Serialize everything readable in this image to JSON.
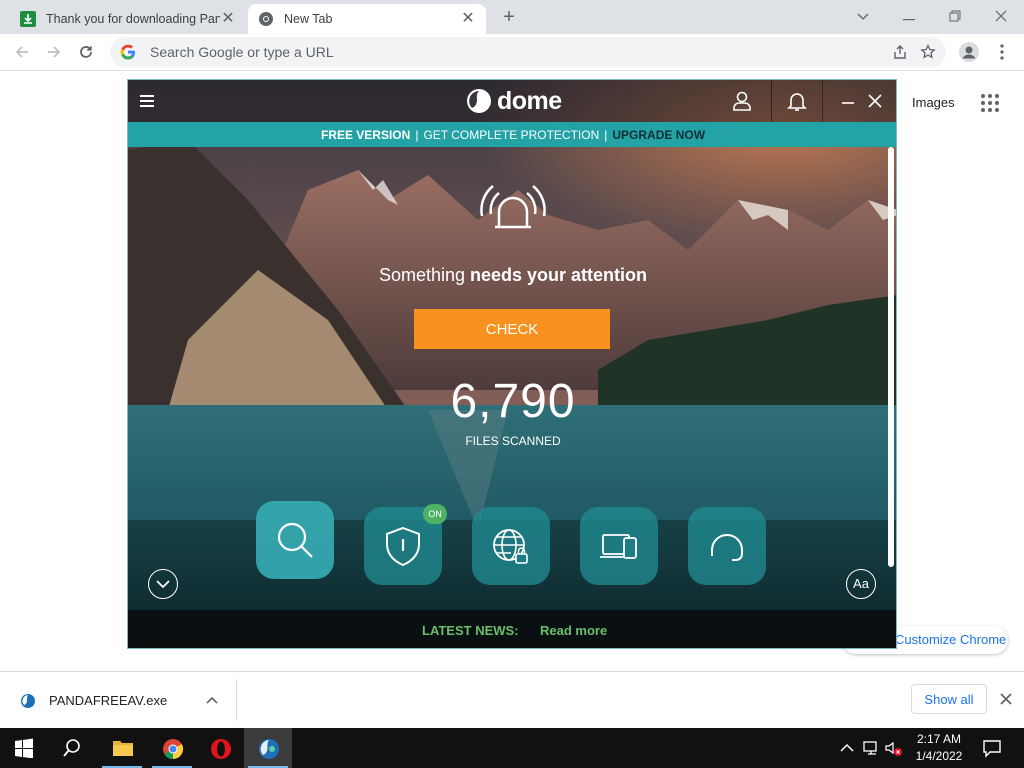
{
  "browser": {
    "tabs": [
      {
        "title": "Thank you for downloading Pand",
        "active": false
      },
      {
        "title": "New Tab",
        "active": true
      }
    ],
    "omnibox_placeholder": "Search Google or type a URL",
    "ntp": {
      "images_link": "Images",
      "customize": "Customize Chrome"
    }
  },
  "dome": {
    "logo_text": "dome",
    "banner": {
      "free_version": "FREE VERSION",
      "get_protection": "GET COMPLETE PROTECTION",
      "upgrade": "UPGRADE NOW",
      "separator": "|"
    },
    "status": {
      "prefix": "Something",
      "emphasis": "needs your attention"
    },
    "check_label": "CHECK",
    "files_count": "6,790",
    "files_label": "FILES SCANNED",
    "modules": [
      {
        "icon": "search-icon",
        "selected": true
      },
      {
        "icon": "shield-icon",
        "badge": "ON"
      },
      {
        "icon": "globe-lock-icon"
      },
      {
        "icon": "devices-icon"
      },
      {
        "icon": "headset-icon"
      }
    ],
    "aa_label": "Aa",
    "news": {
      "label": "LATEST NEWS:",
      "link": "Read more"
    },
    "colors": {
      "accent_teal": "#23a3a6",
      "check_orange": "#f8911e",
      "news_green": "#6bbf6b",
      "badge_green": "#4fb163"
    }
  },
  "downloads": {
    "file_name": "PANDAFREEAV.exe",
    "show_all": "Show all"
  },
  "taskbar": {
    "apps": [
      "start-icon",
      "search-icon",
      "file-explorer-icon",
      "chrome-icon",
      "opera-icon",
      "panda-dome-icon"
    ],
    "clock_time": "2:17 AM",
    "clock_date": "1/4/2022"
  }
}
